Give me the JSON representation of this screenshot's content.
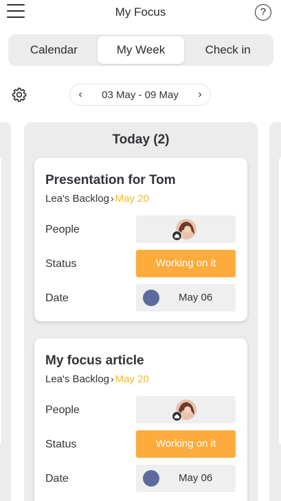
{
  "header": {
    "title": "My Focus",
    "help_symbol": "?",
    "menu_icon": "hamburger-menu-icon",
    "help_icon": "help-circle-icon"
  },
  "tabs": [
    {
      "label": "Calendar",
      "active": false
    },
    {
      "label": "My Week",
      "active": true
    },
    {
      "label": "Check in",
      "active": false
    }
  ],
  "toolbar": {
    "settings_icon": "gear-icon",
    "week_range": "03 May - 09 May",
    "prev_symbol": "‹",
    "next_symbol": "›"
  },
  "column": {
    "heading": "Today (2)",
    "cards": [
      {
        "title": "Presentation for Tom",
        "board": "Lea's Backlog",
        "separator": "›",
        "group": "May 20",
        "people_label": "People",
        "status_label": "Status",
        "status_value": "Working on it",
        "date_label": "Date",
        "date_value": "May 06"
      },
      {
        "title": "My focus article",
        "board": "Lea's Backlog",
        "separator": "›",
        "group": "May 20",
        "people_label": "People",
        "status_label": "Status",
        "status_value": "Working on it",
        "date_label": "Date",
        "date_value": "May 06"
      }
    ]
  },
  "colors": {
    "status_working": "#fdab3d",
    "group_accent": "#f5b82e",
    "date_dot": "#5c6a9e",
    "column_bg": "#ececec"
  }
}
